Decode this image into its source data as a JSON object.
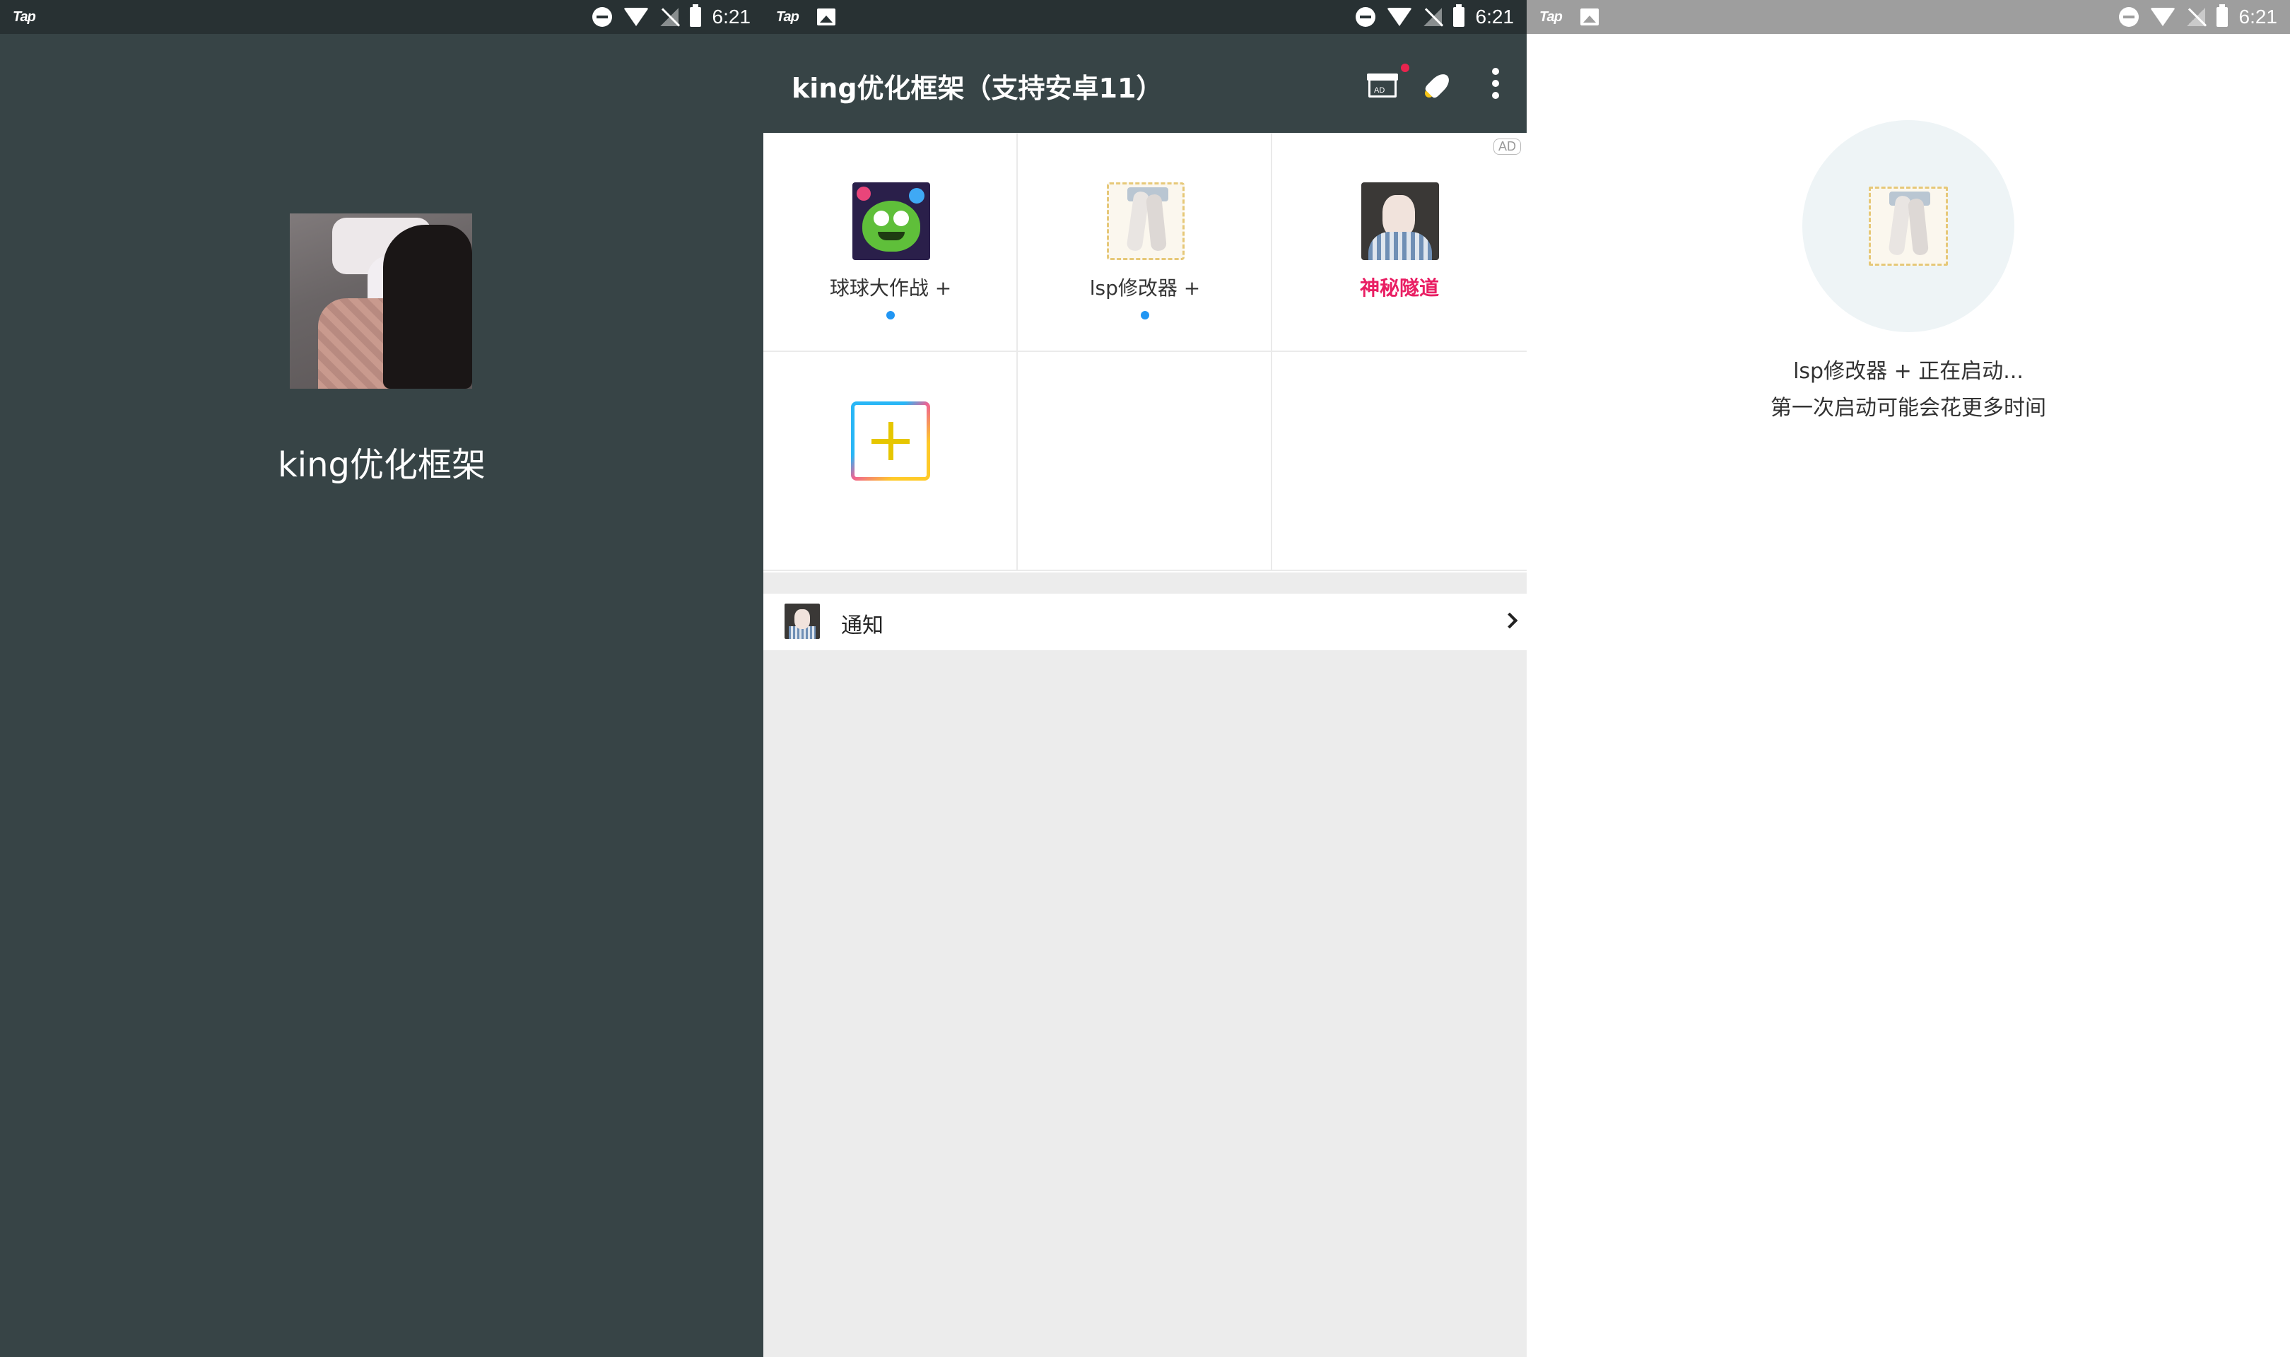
{
  "status_bar": {
    "app_tag": "Tap",
    "time": "6:21"
  },
  "splash": {
    "title": "king优化框架"
  },
  "main": {
    "toolbar": {
      "title": "king优化框架（支持安卓11）",
      "gift_ad_label": "AD"
    },
    "ad_badge": "AD",
    "apps": [
      {
        "label": "球球大作战 +",
        "has_new_dot": true,
        "icon": "game-icon"
      },
      {
        "label": "lsp修改器 +",
        "has_new_dot": true,
        "icon": "legs-photo-icon"
      },
      {
        "label": "神秘隧道",
        "has_new_dot": false,
        "icon": "person-photo-icon",
        "color": "#e91e63"
      }
    ],
    "notice": {
      "label": "通知"
    },
    "colors": {
      "toolbar": "#374446",
      "accent_red": "#e91e63",
      "dot_blue": "#2196f3"
    }
  },
  "loading": {
    "line1": "lsp修改器 + 正在启动...",
    "line2": "第一次启动可能会花更多时间"
  }
}
